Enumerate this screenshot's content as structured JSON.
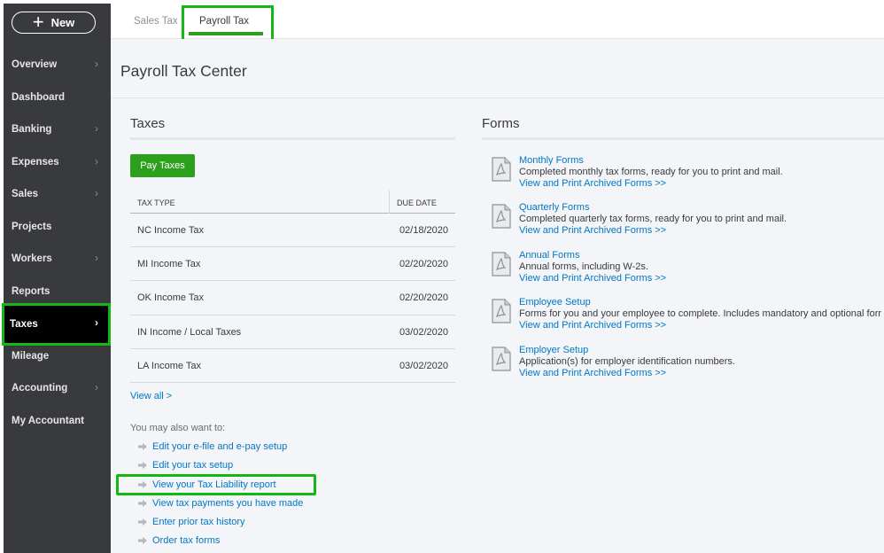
{
  "sidebar": {
    "new_label": "New",
    "items": [
      {
        "label": "Overview",
        "chevron": true
      },
      {
        "label": "Dashboard",
        "chevron": false
      },
      {
        "label": "Banking",
        "chevron": true
      },
      {
        "label": "Expenses",
        "chevron": true
      },
      {
        "label": "Sales",
        "chevron": true
      },
      {
        "label": "Projects",
        "chevron": false
      },
      {
        "label": "Workers",
        "chevron": true
      },
      {
        "label": "Reports",
        "chevron": false
      },
      {
        "label": "Taxes",
        "chevron": true,
        "active": true
      },
      {
        "label": "Mileage",
        "chevron": false
      },
      {
        "label": "Accounting",
        "chevron": true
      },
      {
        "label": "My Accountant",
        "chevron": false
      }
    ]
  },
  "tabs": [
    {
      "label": "Sales Tax",
      "selected": false
    },
    {
      "label": "Payroll Tax",
      "selected": true
    }
  ],
  "page_title": "Payroll Tax Center",
  "taxes": {
    "title": "Taxes",
    "pay_button": "Pay Taxes",
    "columns": [
      "TAX TYPE",
      "DUE DATE"
    ],
    "rows": [
      {
        "type": "NC Income Tax",
        "due": "02/18/2020"
      },
      {
        "type": "MI Income Tax",
        "due": "02/20/2020"
      },
      {
        "type": "OK Income Tax",
        "due": "02/20/2020"
      },
      {
        "type": "IN Income / Local Taxes",
        "due": "03/02/2020"
      },
      {
        "type": "LA Income Tax",
        "due": "03/02/2020"
      }
    ],
    "view_all": "View all >"
  },
  "also": {
    "title": "You may also want to:",
    "links": [
      "Edit your e-file and e-pay setup",
      "Edit your tax setup",
      "View your Tax Liability report",
      "View tax payments you have made",
      "Enter prior tax history",
      "Order tax forms"
    ]
  },
  "forms": {
    "title": "Forms",
    "items": [
      {
        "title": "Monthly Forms",
        "desc": "Completed monthly tax forms, ready for you to print and mail.",
        "link": "View and Print Archived Forms >>"
      },
      {
        "title": "Quarterly Forms",
        "desc": "Completed quarterly tax forms, ready for you to print and mail.",
        "link": "View and Print Archived Forms >>"
      },
      {
        "title": "Annual Forms",
        "desc": "Annual forms, including W-2s.",
        "link": "View and Print Archived Forms >>"
      },
      {
        "title": "Employee Setup",
        "desc": "Forms for you and your employee to complete. Includes mandatory and optional forr",
        "link": "View and Print Archived Forms >>"
      },
      {
        "title": "Employer Setup",
        "desc": "Application(s) for employer identification numbers.",
        "link": "View and Print Archived Forms >>"
      }
    ]
  },
  "colors": {
    "sidebar_bg": "#393a3d",
    "accent_green": "#2ca01c",
    "highlight_green": "#14b814",
    "link_blue": "#0077c5"
  }
}
